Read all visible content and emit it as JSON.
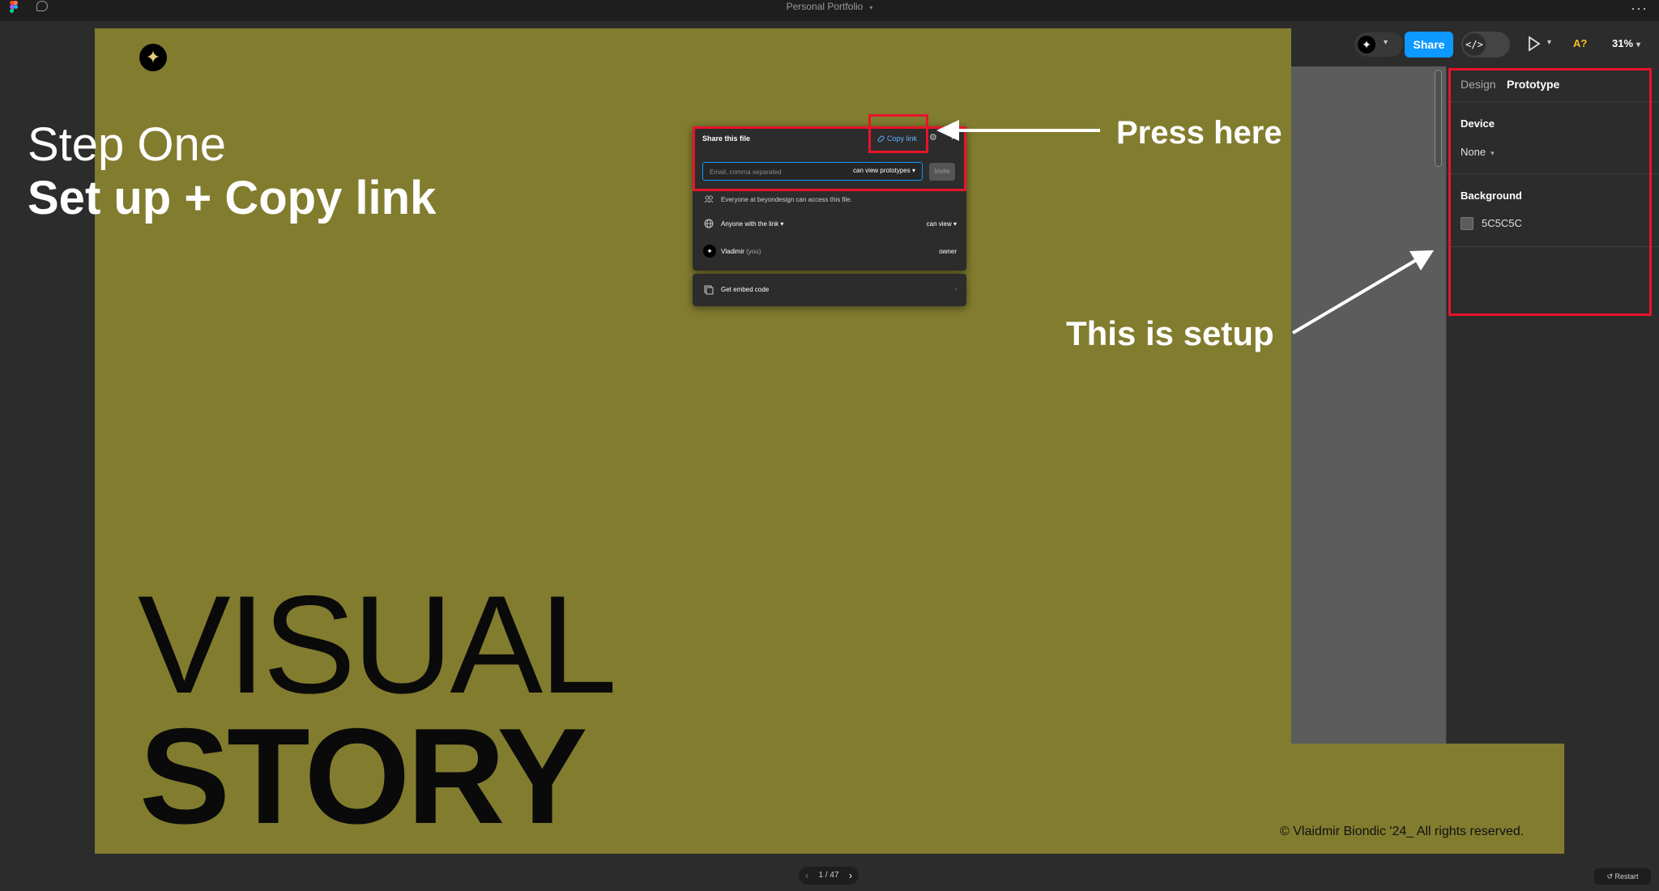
{
  "app": {
    "file_title": "Personal Portfolio",
    "more_menu": "···"
  },
  "toolbar": {
    "share_label": "Share",
    "code_label": "</>",
    "a_label": "A?",
    "zoom": "31%"
  },
  "panel": {
    "tabs": [
      "Design",
      "Prototype"
    ],
    "device_title": "Device",
    "device_value": "None",
    "background_title": "Background",
    "background_value": "5C5C5C"
  },
  "share_dialog": {
    "title": "Share this file",
    "copy_link": "Copy link",
    "email_placeholder": "Email, comma separated",
    "email_permission": "can view prototypes",
    "invite_label": "Invite",
    "org_access": "Everyone at beyondesign can access this file.",
    "link_access": "Anyone with the link",
    "link_permission": "can view",
    "user_name": "Vladimir",
    "user_suffix": "(you)",
    "user_role": "owner",
    "embed_label": "Get embed code"
  },
  "slide": {
    "visual": "VISUAL",
    "story": "STORY",
    "copyright": "© Vlaidmir Biondic '24_ All rights reserved."
  },
  "footer": {
    "pager": "1 / 47",
    "restart": "Restart"
  },
  "annotations": {
    "step_one": "Step One",
    "step_sub": "Set up + Copy link",
    "press_here": "Press here",
    "this_is_setup": "This is setup"
  },
  "colors": {
    "slide_bg": "#827c2f",
    "accent_blue": "#0d99ff",
    "highlight_red": "#e8142a",
    "panel_bg": "#2c2c2c"
  }
}
